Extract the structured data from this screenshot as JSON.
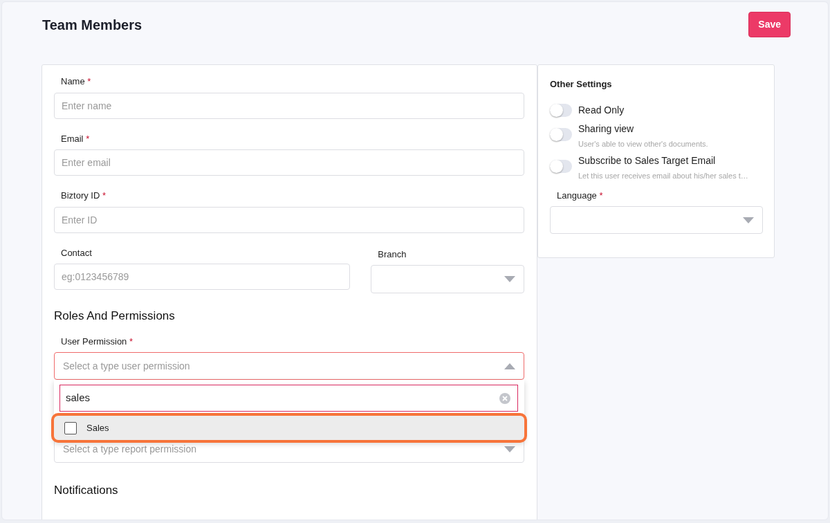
{
  "header": {
    "title": "Team Members",
    "save_button": "Save"
  },
  "form": {
    "rows": [
      {
        "fields": [
          {
            "kind": "text",
            "label": "Name",
            "required_mark": "*",
            "placeholder": "Enter name"
          }
        ]
      },
      {
        "fields": [
          {
            "kind": "text",
            "label": "Email",
            "required_mark": "*",
            "placeholder": "Enter email"
          }
        ]
      },
      {
        "fields": [
          {
            "kind": "text",
            "label": "Biztory ID",
            "required_mark": "*",
            "placeholder": "Enter ID"
          }
        ]
      },
      {
        "fields": [
          {
            "kind": "text",
            "label": "Contact",
            "placeholder": "eg:0123456789"
          },
          {
            "kind": "select",
            "label": "Branch"
          }
        ]
      }
    ],
    "roles": {
      "heading": "Roles And Permissions",
      "user_permission": {
        "label": "User Permission",
        "required_mark": "*",
        "placeholder": "Select a type user permission",
        "open": true,
        "dropdown": {
          "search_value": "sales",
          "options": [
            {
              "label": "Sales",
              "checked": false,
              "highlighted": true
            }
          ]
        }
      },
      "report_permission": {
        "placeholder": "Select a type report permission"
      }
    },
    "notifications_heading": "Notifications"
  },
  "settings": {
    "title": "Other Settings",
    "toggles": [
      {
        "label": "Read Only",
        "on": false
      },
      {
        "label": "Sharing view",
        "hint": "User's able to view other's documents.",
        "on": false
      },
      {
        "label": "Subscribe to Sales Target Email",
        "hint": "Let this user receives email about his/her sales t…",
        "on": false
      }
    ],
    "language": {
      "label": "Language",
      "required_mark": "*"
    }
  }
}
